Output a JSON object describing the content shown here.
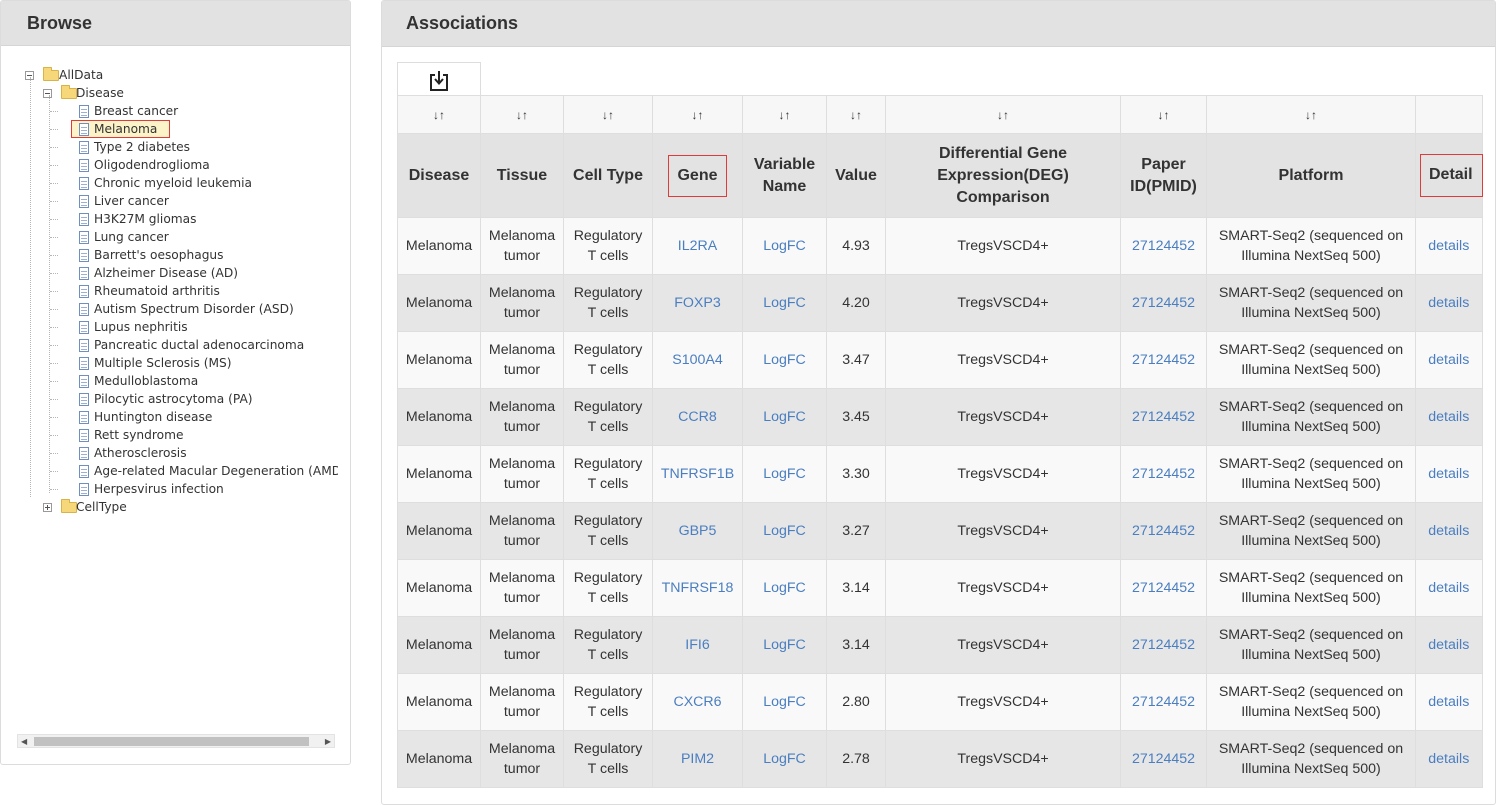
{
  "browse": {
    "title": "Browse",
    "tree": {
      "root": "AllData",
      "disease_folder": "Disease",
      "diseases": [
        "Breast cancer",
        "Melanoma",
        "Type 2 diabetes",
        "Oligodendroglioma",
        "Chronic myeloid leukemia",
        "Liver cancer",
        "H3K27M gliomas",
        "Lung cancer",
        "Barrett's oesophagus",
        "Alzheimer Disease (AD)",
        "Rheumatoid arthritis",
        "Autism Spectrum Disorder (ASD)",
        "Lupus nephritis",
        "Pancreatic ductal adenocarcinoma",
        "Multiple Sclerosis (MS)",
        "Medulloblastoma",
        "Pilocytic astrocytoma (PA)",
        "Huntington disease",
        "Rett syndrome",
        "Atherosclerosis",
        "Age-related Macular Degeneration (AMD",
        "Herpesvirus infection"
      ],
      "selected": "Melanoma",
      "celltype_folder": "CellType"
    }
  },
  "associations": {
    "title": "Associations",
    "download_icon": "download-icon",
    "sort_icon": "↓↑",
    "columns": [
      "Disease",
      "Tissue",
      "Cell Type",
      "Gene",
      "Variable Name",
      "Value",
      "Differential Gene Expression(DEG) Comparison",
      "Paper ID(PMID)",
      "Platform",
      "Detail"
    ],
    "rows": [
      {
        "disease": "Melanoma",
        "tissue": "Melanoma tumor",
        "cell_type": "Regulatory T cells",
        "gene": "IL2RA",
        "variable": "LogFC",
        "value": "4.93",
        "deg": "TregsVSCD4+",
        "pmid": "27124452",
        "platform": "SMART-Seq2 (sequenced on Illumina NextSeq 500)",
        "detail": "details"
      },
      {
        "disease": "Melanoma",
        "tissue": "Melanoma tumor",
        "cell_type": "Regulatory T cells",
        "gene": "FOXP3",
        "variable": "LogFC",
        "value": "4.20",
        "deg": "TregsVSCD4+",
        "pmid": "27124452",
        "platform": "SMART-Seq2 (sequenced on Illumina NextSeq 500)",
        "detail": "details"
      },
      {
        "disease": "Melanoma",
        "tissue": "Melanoma tumor",
        "cell_type": "Regulatory T cells",
        "gene": "S100A4",
        "variable": "LogFC",
        "value": "3.47",
        "deg": "TregsVSCD4+",
        "pmid": "27124452",
        "platform": "SMART-Seq2 (sequenced on Illumina NextSeq 500)",
        "detail": "details"
      },
      {
        "disease": "Melanoma",
        "tissue": "Melanoma tumor",
        "cell_type": "Regulatory T cells",
        "gene": "CCR8",
        "variable": "LogFC",
        "value": "3.45",
        "deg": "TregsVSCD4+",
        "pmid": "27124452",
        "platform": "SMART-Seq2 (sequenced on Illumina NextSeq 500)",
        "detail": "details"
      },
      {
        "disease": "Melanoma",
        "tissue": "Melanoma tumor",
        "cell_type": "Regulatory T cells",
        "gene": "TNFRSF1B",
        "variable": "LogFC",
        "value": "3.30",
        "deg": "TregsVSCD4+",
        "pmid": "27124452",
        "platform": "SMART-Seq2 (sequenced on Illumina NextSeq 500)",
        "detail": "details"
      },
      {
        "disease": "Melanoma",
        "tissue": "Melanoma tumor",
        "cell_type": "Regulatory T cells",
        "gene": "GBP5",
        "variable": "LogFC",
        "value": "3.27",
        "deg": "TregsVSCD4+",
        "pmid": "27124452",
        "platform": "SMART-Seq2 (sequenced on Illumina NextSeq 500)",
        "detail": "details"
      },
      {
        "disease": "Melanoma",
        "tissue": "Melanoma tumor",
        "cell_type": "Regulatory T cells",
        "gene": "TNFRSF18",
        "variable": "LogFC",
        "value": "3.14",
        "deg": "TregsVSCD4+",
        "pmid": "27124452",
        "platform": "SMART-Seq2 (sequenced on Illumina NextSeq 500)",
        "detail": "details"
      },
      {
        "disease": "Melanoma",
        "tissue": "Melanoma tumor",
        "cell_type": "Regulatory T cells",
        "gene": "IFI6",
        "variable": "LogFC",
        "value": "3.14",
        "deg": "TregsVSCD4+",
        "pmid": "27124452",
        "platform": "SMART-Seq2 (sequenced on Illumina NextSeq 500)",
        "detail": "details"
      },
      {
        "disease": "Melanoma",
        "tissue": "Melanoma tumor",
        "cell_type": "Regulatory T cells",
        "gene": "CXCR6",
        "variable": "LogFC",
        "value": "2.80",
        "deg": "TregsVSCD4+",
        "pmid": "27124452",
        "platform": "SMART-Seq2 (sequenced on Illumina NextSeq 500)",
        "detail": "details"
      },
      {
        "disease": "Melanoma",
        "tissue": "Melanoma tumor",
        "cell_type": "Regulatory T cells",
        "gene": "PIM2",
        "variable": "LogFC",
        "value": "2.78",
        "deg": "TregsVSCD4+",
        "pmid": "27124452",
        "platform": "SMART-Seq2 (sequenced on Illumina NextSeq 500)",
        "detail": "details"
      }
    ]
  },
  "colors": {
    "link": "#4a7ec0",
    "highlight_border": "#e03a3a",
    "header_bg": "#e2e2e2"
  }
}
